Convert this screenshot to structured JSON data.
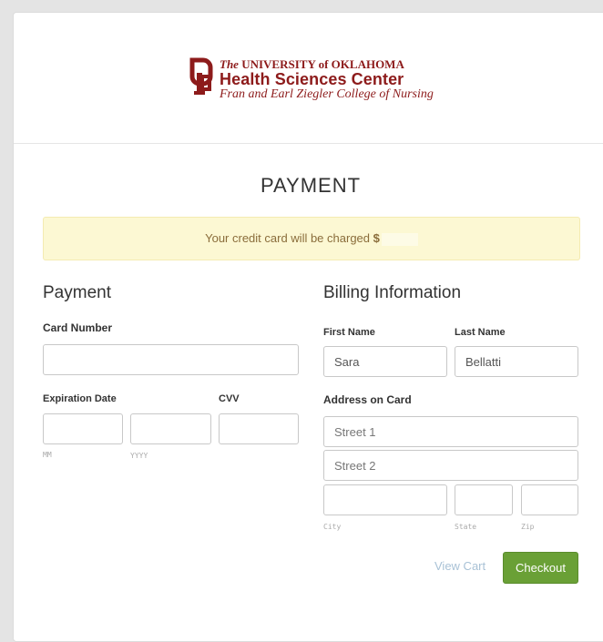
{
  "logo": {
    "line1_prefix": "The",
    "line1_rest": " UNIVERSITY of OKLAHOMA",
    "line2": "Health Sciences Center",
    "line3": "Fran and Earl Ziegler College of Nursing"
  },
  "page_title": "PAYMENT",
  "alert": {
    "text": "Your credit card will be charged",
    "currency": "$"
  },
  "payment": {
    "heading": "Payment",
    "card_number_label": "Card Number",
    "expiration_label": "Expiration Date",
    "cvv_label": "CVV",
    "month_hint": "MM",
    "year_hint": "YYYY"
  },
  "billing": {
    "heading": "Billing Information",
    "first_name_label": "First Name",
    "first_name_value": "Sara",
    "last_name_label": "Last Name",
    "last_name_value": "Bellatti",
    "address_label": "Address on Card",
    "street1_placeholder": "Street 1",
    "street2_placeholder": "Street 2",
    "city_hint": "City",
    "state_hint": "State",
    "zip_hint": "Zip"
  },
  "actions": {
    "view_cart": "View Cart",
    "checkout": "Checkout"
  },
  "colors": {
    "brand": "#8d1b1b",
    "checkout_button": "#6aa036",
    "alert_bg": "#fcf8d3"
  }
}
